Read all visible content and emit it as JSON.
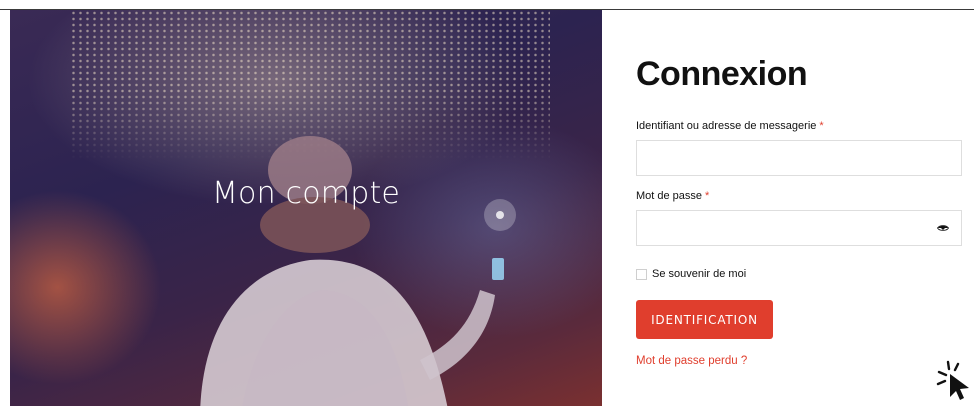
{
  "hero": {
    "title": "Mon compte"
  },
  "login": {
    "title": "Connexion",
    "username_label": "Identifiant ou adresse de messagerie",
    "username_value": "",
    "password_label": "Mot de passe",
    "password_value": "",
    "required_mark": "*",
    "remember_label": "Se souvenir de moi",
    "submit_label": "IDENTIFICATION",
    "lost_password_label": "Mot de passe perdu ?"
  },
  "icons": {
    "password_toggle": "eye-icon",
    "cursor": "click-cursor-icon"
  },
  "colors": {
    "accent": "#e03e2d",
    "text": "#111111",
    "input_border": "#dedede"
  }
}
